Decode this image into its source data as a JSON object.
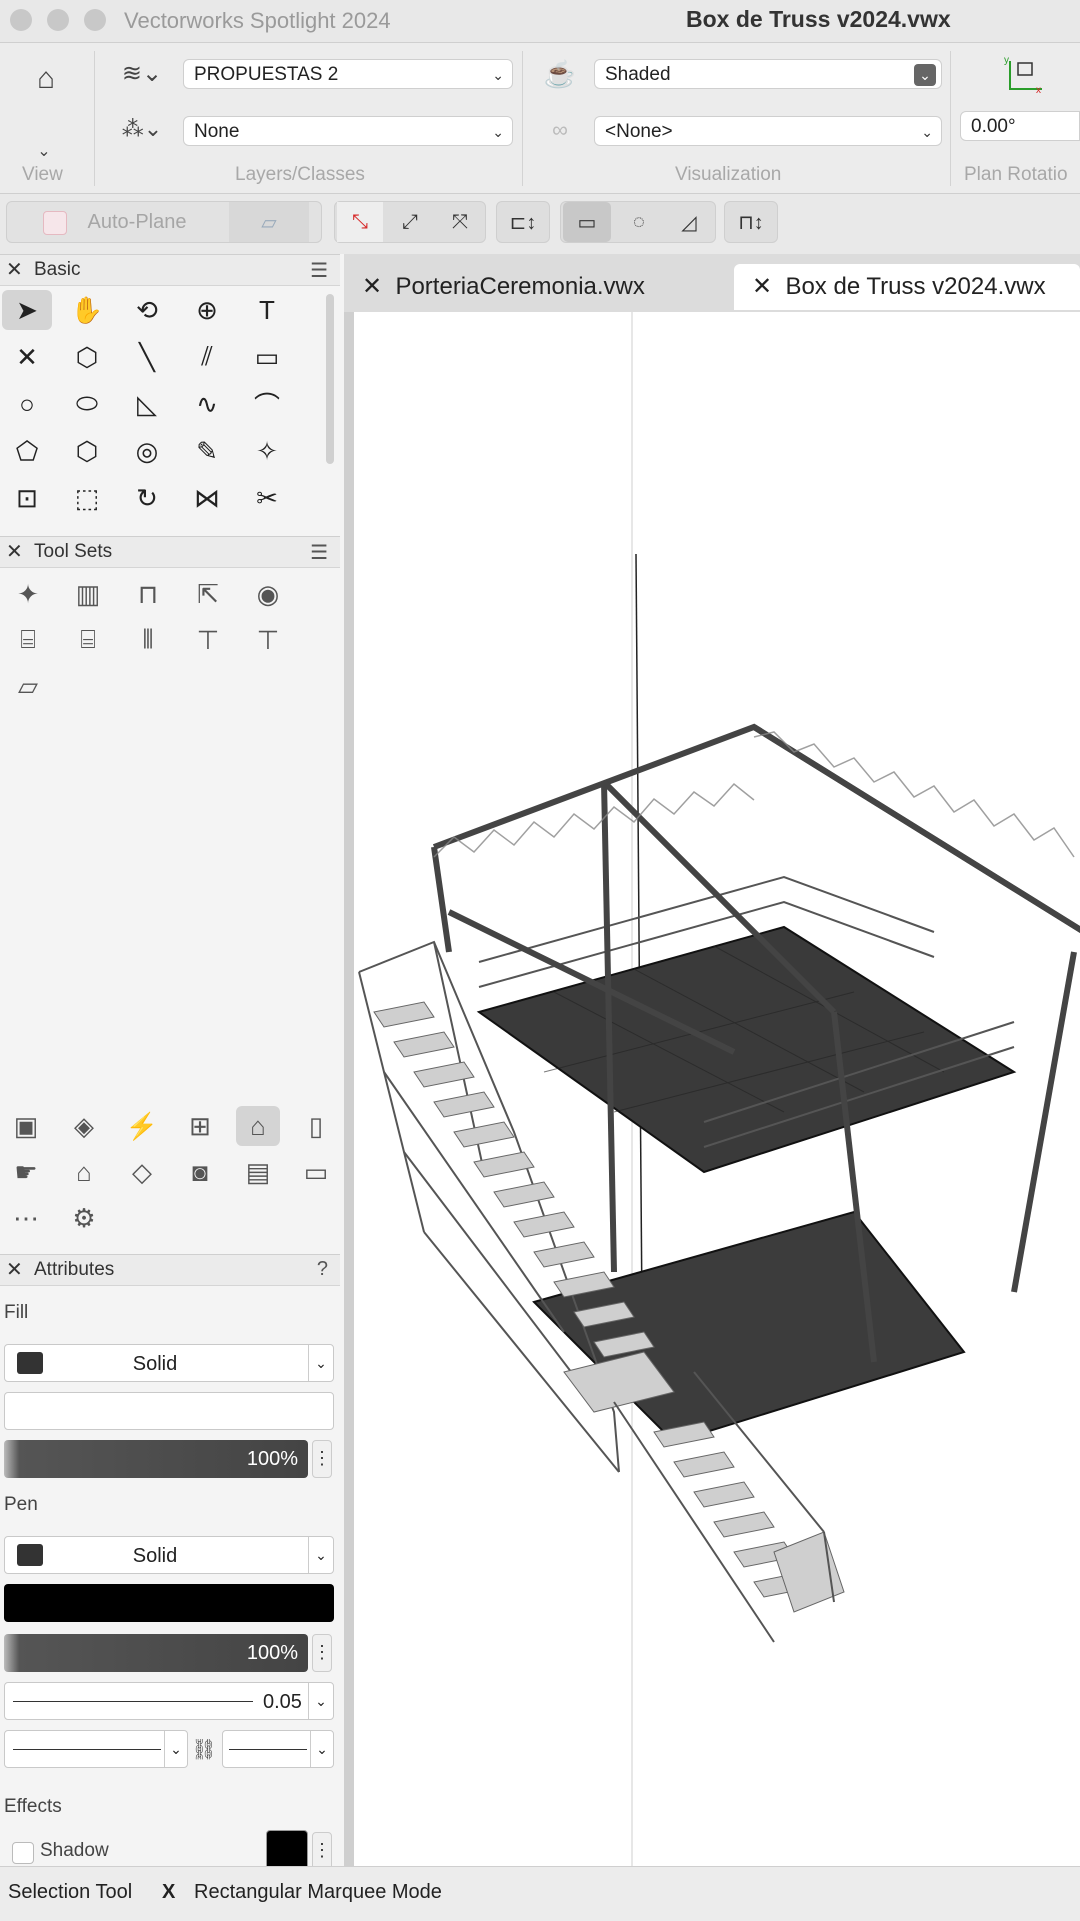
{
  "window": {
    "app_title": "Vectorworks Spotlight 2024",
    "document_title": "Box de Truss v2024.vwx"
  },
  "view_bar": {
    "groups": {
      "view": "View",
      "layers_classes": "Layers/Classes",
      "visualization": "Visualization",
      "plan_rotation": "Plan Rotatio"
    },
    "layer_value": "PROPUESTAS 2",
    "class_value": "None",
    "render_mode": "Shaded",
    "viewpoint": "<None>",
    "rotation_value": "0.00°"
  },
  "toolbar2": {
    "auto_plane_label": "Auto-Plane"
  },
  "basic_palette": {
    "title": "Basic",
    "tools": [
      {
        "name": "selection-tool",
        "glyph": "➤"
      },
      {
        "name": "pan-tool",
        "glyph": "✋"
      },
      {
        "name": "flyover-tool",
        "glyph": "⟲"
      },
      {
        "name": "zoom-tool",
        "glyph": "⊕"
      },
      {
        "name": "text-tool",
        "glyph": "T"
      },
      {
        "name": "locus-tool",
        "glyph": "✕"
      },
      {
        "name": "3d-locus-tool",
        "glyph": "⬡"
      },
      {
        "name": "line-tool",
        "glyph": "╲"
      },
      {
        "name": "double-line-tool",
        "glyph": "⫽"
      },
      {
        "name": "rectangle-tool",
        "glyph": "▭"
      },
      {
        "name": "circle-tool",
        "glyph": "○"
      },
      {
        "name": "oval-tool",
        "glyph": "⬭"
      },
      {
        "name": "arc-tool",
        "glyph": "◺"
      },
      {
        "name": "freehand-tool",
        "glyph": "∿"
      },
      {
        "name": "polyline-tool",
        "glyph": "⌒"
      },
      {
        "name": "polygon-tool",
        "glyph": "⬠"
      },
      {
        "name": "regular-polygon-tool",
        "glyph": "⬡"
      },
      {
        "name": "spiral-tool",
        "glyph": "◎"
      },
      {
        "name": "eyedropper-tool",
        "glyph": "✎"
      },
      {
        "name": "magic-wand-tool",
        "glyph": "✧"
      },
      {
        "name": "move-by-points-tool",
        "glyph": "⊡"
      },
      {
        "name": "reshape-tool",
        "glyph": "⬚"
      },
      {
        "name": "rotate-tool",
        "glyph": "↻"
      },
      {
        "name": "mirror-tool",
        "glyph": "⋈"
      },
      {
        "name": "split-tool",
        "glyph": "✂"
      }
    ]
  },
  "tool_sets": {
    "title": "Tool Sets",
    "sets": [
      {
        "name": "lighting-set",
        "glyph": "✦"
      },
      {
        "name": "fence-set",
        "glyph": "▥"
      },
      {
        "name": "truss-set",
        "glyph": "⊓"
      },
      {
        "name": "rigging-set",
        "glyph": "⇱"
      },
      {
        "name": "visualization-set",
        "glyph": "◉"
      },
      {
        "name": "seating-set",
        "glyph": "⌸"
      },
      {
        "name": "audience-set",
        "glyph": "⌸"
      },
      {
        "name": "soft-goods-set",
        "glyph": "⦀"
      },
      {
        "name": "staging-set",
        "glyph": "⊤"
      },
      {
        "name": "platform-set",
        "glyph": "⊤"
      },
      {
        "name": "stage-deck-set",
        "glyph": "▱"
      }
    ],
    "bottom_sets": [
      {
        "name": "video-set",
        "glyph": "▣"
      },
      {
        "name": "projector-set",
        "glyph": "◈"
      },
      {
        "name": "electrical-set",
        "glyph": "⚡"
      },
      {
        "name": "cable-set",
        "glyph": "⊞"
      },
      {
        "name": "scenic-set",
        "glyph": "⌂"
      },
      {
        "name": "door-set",
        "glyph": "▯"
      },
      {
        "name": "hand-tool-set",
        "glyph": "☛"
      },
      {
        "name": "building-set",
        "glyph": "⌂"
      },
      {
        "name": "glass-set",
        "glyph": "◇"
      },
      {
        "name": "camera-set",
        "glyph": "◙"
      },
      {
        "name": "cabinet-set",
        "glyph": "▤"
      },
      {
        "name": "shelf-set",
        "glyph": "▭"
      },
      {
        "name": "fastener-set",
        "glyph": "⋯"
      },
      {
        "name": "gear-set",
        "glyph": "⚙"
      }
    ]
  },
  "attributes": {
    "title": "Attributes",
    "help": "?",
    "fill_label": "Fill",
    "fill_style": "Solid",
    "fill_opacity": "100%",
    "pen_label": "Pen",
    "pen_style": "Solid",
    "pen_opacity": "100%",
    "line_weight": "0.05",
    "effects_label": "Effects",
    "shadow_label": "Shadow"
  },
  "tabs": [
    {
      "label": "PorteriaCeremonia.vwx",
      "active": false
    },
    {
      "label": "Box de Truss v2024.vwx",
      "active": true
    }
  ],
  "status": {
    "tool": "Selection Tool",
    "shortcut": "X",
    "mode": "Rectangular Marquee Mode"
  },
  "colors": {
    "accent_red": "#d62828",
    "panel": "#f4f4f4",
    "deck": "#3a3a3a"
  }
}
